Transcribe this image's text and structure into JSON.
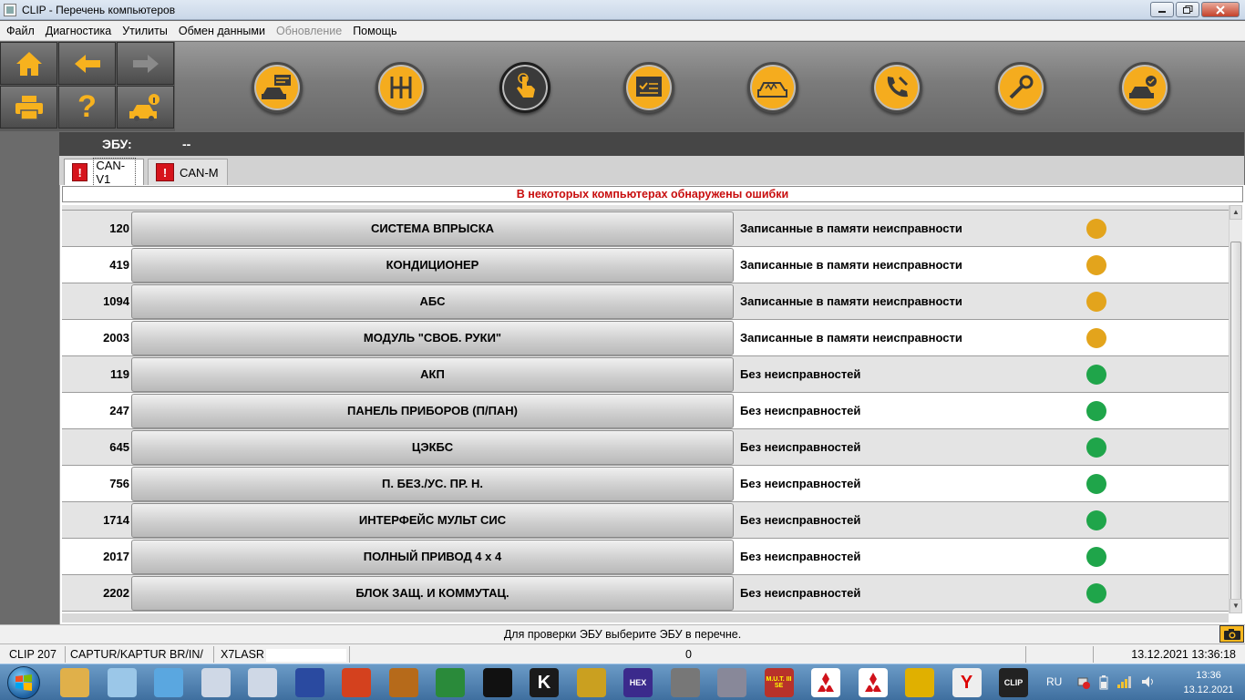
{
  "window": {
    "title": "CLIP - Перечень компьютеров"
  },
  "menu": [
    {
      "label": "Файл",
      "disabled": false
    },
    {
      "label": "Диагностика",
      "disabled": false
    },
    {
      "label": "Утилиты",
      "disabled": false
    },
    {
      "label": "Обмен данными",
      "disabled": false
    },
    {
      "label": "Обновление",
      "disabled": true
    },
    {
      "label": "Помощь",
      "disabled": false
    }
  ],
  "nav_buttons": [
    {
      "id": "home",
      "icon": "home-icon"
    },
    {
      "id": "back",
      "icon": "arrow-left-icon"
    },
    {
      "id": "forward",
      "icon": "arrow-right-icon"
    },
    {
      "id": "print",
      "icon": "printer-icon"
    },
    {
      "id": "help",
      "icon": "question-icon",
      "text": "?"
    },
    {
      "id": "vehicle-info",
      "icon": "car-info-icon"
    }
  ],
  "toolbar": [
    {
      "id": "vehicle-id",
      "icon": "car-message-icon",
      "active": false
    },
    {
      "id": "gearbox",
      "icon": "gearbox-icon",
      "active": false
    },
    {
      "id": "touch",
      "icon": "touch-icon",
      "active": true
    },
    {
      "id": "checklist",
      "icon": "checklist-icon",
      "active": false
    },
    {
      "id": "diagnostic",
      "icon": "car-diagnostic-icon",
      "active": false
    },
    {
      "id": "service-call",
      "icon": "phone-wrench-icon",
      "active": false
    },
    {
      "id": "repair",
      "icon": "wrench-icon",
      "active": false
    },
    {
      "id": "vehicle-ok",
      "icon": "car-check-icon",
      "active": false
    }
  ],
  "ecu": {
    "label": "ЭБУ:",
    "value": "--"
  },
  "tabs": [
    {
      "label": "CAN-V1",
      "active": true,
      "error_mark": "!"
    },
    {
      "label": "CAN-M",
      "active": false,
      "error_mark": "!"
    }
  ],
  "warning": "В некоторых компьютерах обнаружены ошибки",
  "ecu_rows": [
    {
      "code": "120",
      "name": "СИСТЕМА ВПРЫСКА",
      "status": "Записанные в памяти неисправности",
      "state": "fault"
    },
    {
      "code": "419",
      "name": "КОНДИЦИОНЕР",
      "status": "Записанные в памяти неисправности",
      "state": "fault"
    },
    {
      "code": "1094",
      "name": "АБС",
      "status": "Записанные в памяти неисправности",
      "state": "fault"
    },
    {
      "code": "2003",
      "name": "МОДУЛЬ \"СВОБ. РУКИ\"",
      "status": "Записанные в памяти неисправности",
      "state": "fault"
    },
    {
      "code": "119",
      "name": "АКП",
      "status": "Без неисправностей",
      "state": "ok"
    },
    {
      "code": "247",
      "name": "ПАНЕЛЬ ПРИБОРОВ (П/ПАН)",
      "status": "Без неисправностей",
      "state": "ok"
    },
    {
      "code": "645",
      "name": "ЦЭКБС",
      "status": "Без неисправностей",
      "state": "ok"
    },
    {
      "code": "756",
      "name": "П. БЕЗ./УС. ПР. Н.",
      "status": "Без неисправностей",
      "state": "ok"
    },
    {
      "code": "1714",
      "name": "ИНТЕРФЕЙС МУЛЬТ СИС",
      "status": "Без неисправностей",
      "state": "ok"
    },
    {
      "code": "2017",
      "name": "ПОЛНЫЙ ПРИВОД 4 x 4",
      "status": "Без неисправностей",
      "state": "ok"
    },
    {
      "code": "2202",
      "name": "БЛОК ЗАЩ. И КОММУТАЦ.",
      "status": "Без неисправностей",
      "state": "ok"
    }
  ],
  "state_colors": {
    "fault": "#e3a41c",
    "ok": "#1fa54a"
  },
  "hint": "Для проверки ЭБУ выберите ЭБУ в перечне.",
  "statusbar": {
    "version": "CLIP 207",
    "vehicle": "CAPTUR/KAPTUR BR/IN/",
    "vin": "X7LASR",
    "counter": "0",
    "datetime": "13.12.2021 13:36:18"
  },
  "taskbar": {
    "apps": [
      "explorer-icon",
      "paint-icon",
      "computer-icon",
      "diagnostic-app-icon",
      "diagnostic-app-icon",
      "floppy-icon",
      "no-symbol-icon",
      "cartridge-icon",
      "truck-logo-icon",
      "lightning-icon",
      "k-app-icon",
      "coin-icon",
      "hex-app-icon",
      "ecu-box-icon",
      "chip-icon",
      "mut-icon",
      "mitsubishi-icon",
      "mitsubishi-icon",
      "target-icon",
      "yandex-icon",
      "clip-app-icon"
    ],
    "hex_label": "HEX",
    "mut_label": "M.U.T. III SE",
    "k_label": "K",
    "yandex_label": "Y",
    "clip_label": "CLIP",
    "lang": "RU",
    "time": "13:36",
    "date": "13.12.2021"
  }
}
